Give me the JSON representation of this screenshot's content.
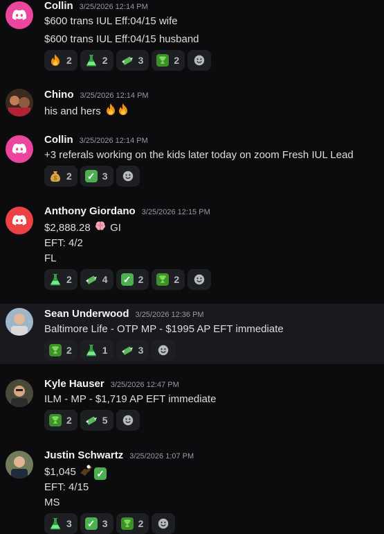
{
  "messages": [
    {
      "user": "Collin",
      "time": "3/25/2026 12:14 PM",
      "lines": [
        "$600 trans IUL Eff:04/15 wife",
        "$600 trans IUL Eff:04/15 husband"
      ],
      "reactions": [
        {
          "emoji": "fire-icon",
          "count": "2"
        },
        {
          "emoji": "flask-icon",
          "count": "2"
        },
        {
          "emoji": "money-wings-icon",
          "count": "3"
        },
        {
          "emoji": "trophy-icon",
          "count": "2"
        }
      ]
    },
    {
      "user": "Chino",
      "time": "3/25/2026 12:14 PM",
      "lines": [
        "his and hers"
      ]
    },
    {
      "user": "Collin",
      "time": "3/25/2026 12:14 PM",
      "lines": [
        "+3 referals working on the kids later today on zoom Fresh IUL Lead"
      ],
      "reactions": [
        {
          "emoji": "money-bag-icon",
          "count": "2"
        },
        {
          "emoji": "check-icon",
          "count": "3"
        }
      ]
    },
    {
      "user": "Anthony Giordano",
      "time": "3/25/2026 12:15 PM",
      "lines": [
        "$2,888.28",
        "GI",
        "EFT: 4/2",
        "FL"
      ],
      "reactions": [
        {
          "emoji": "flask-icon",
          "count": "2"
        },
        {
          "emoji": "money-wings-icon",
          "count": "4"
        },
        {
          "emoji": "check-icon",
          "count": "2"
        },
        {
          "emoji": "trophy-icon",
          "count": "2"
        }
      ]
    },
    {
      "user": "Sean Underwood",
      "time": "3/25/2026 12:36 PM",
      "lines": [
        "Baltimore Life - OTP MP - $1995 AP EFT immediate"
      ],
      "reactions": [
        {
          "emoji": "trophy-icon",
          "count": "2"
        },
        {
          "emoji": "flask-icon",
          "count": "1"
        },
        {
          "emoji": "money-wings-icon",
          "count": "3"
        }
      ]
    },
    {
      "user": "Kyle Hauser",
      "time": "3/25/2026 12:47 PM",
      "lines": [
        "ILM - MP - $1,719 AP EFT immediate"
      ],
      "reactions": [
        {
          "emoji": "trophy-icon",
          "count": "2"
        },
        {
          "emoji": "money-wings-icon",
          "count": "5"
        }
      ]
    },
    {
      "user": "Justin Schwartz",
      "time": "3/25/2026 1:07 PM",
      "lines": [
        "$1,045",
        "EFT: 4/15",
        "MS"
      ],
      "reactions": [
        {
          "emoji": "flask-icon",
          "count": "3"
        },
        {
          "emoji": "check-icon",
          "count": "3"
        },
        {
          "emoji": "trophy-icon",
          "count": "2"
        }
      ]
    }
  ],
  "colors": {
    "accent_pink": "#eb459e",
    "accent_red": "#ed4245",
    "reaction_bg": "#1e1f22",
    "highlight_bg": "#1a1a1e"
  }
}
